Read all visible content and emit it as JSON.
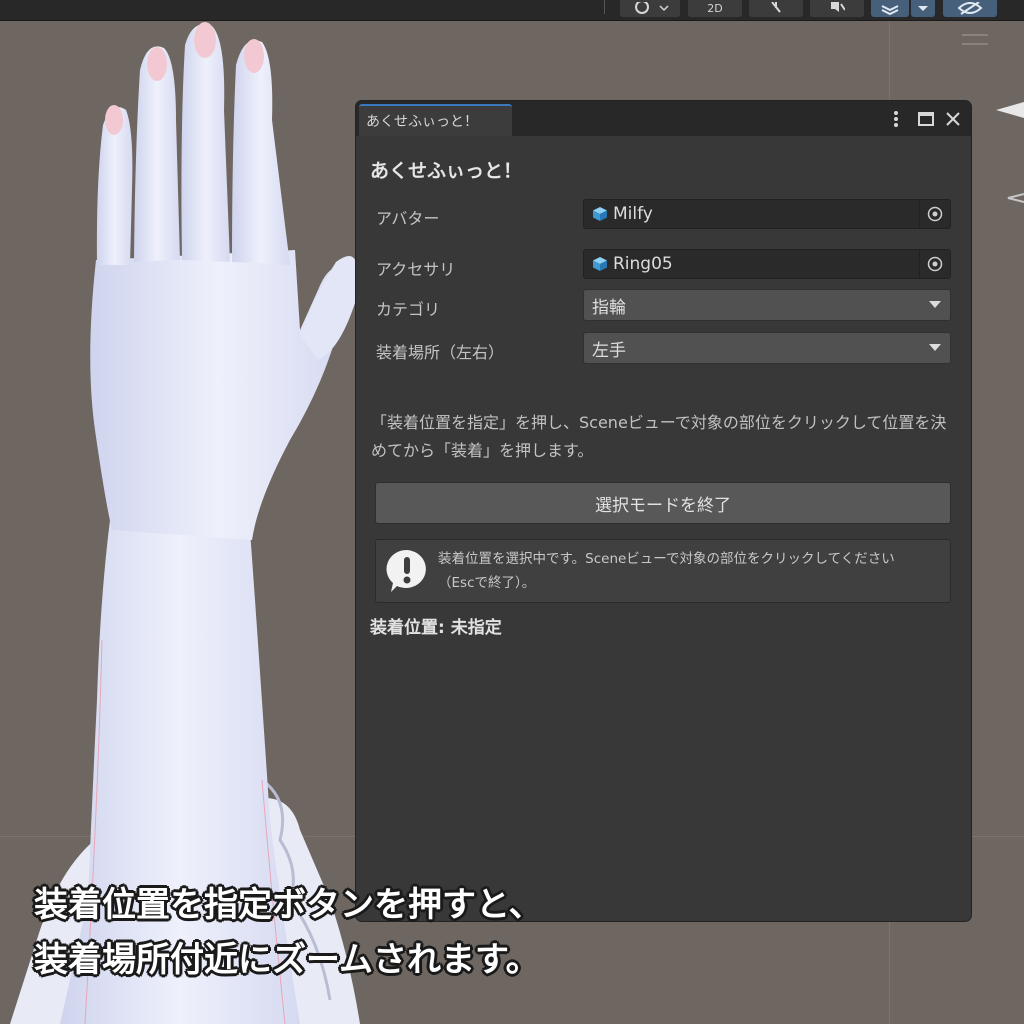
{
  "toolbar": {
    "mode_2d_label": "2D"
  },
  "window": {
    "tab_label": "あくせふぃっと！",
    "title": "あくせふぃっと！",
    "fields": {
      "avatar_label": "アバター",
      "avatar_value": "Milfy",
      "accessory_label": "アクセサリ",
      "accessory_value": "Ring05",
      "category_label": "カテゴリ",
      "category_value": "指輪",
      "side_label": "装着場所（左右）",
      "side_value": "左手"
    },
    "instructions": "「装着位置を指定」を押し、Sceneビューで対象の部位をクリックして位置を決めてから「装着」を押します。",
    "mode_button_label": "選択モードを終了",
    "helpbox": {
      "line1": "装着位置を選択中です。Sceneビューで対象の部位をクリックしてください",
      "line2": "（Escで終了）。"
    },
    "position_status": "装着位置: 未指定"
  },
  "caption": {
    "line1": "装着位置を指定ボタンを押すと、",
    "line2": "装着場所付近にズームされます。"
  },
  "colors": {
    "scene_bg": "#6e6660",
    "window_bg": "#383838",
    "tab_accent": "#3a79bb",
    "cube_icon": "#4aa9e0"
  },
  "icons": {
    "cube": "prefab-cube-icon",
    "target": "object-picker-icon",
    "warning": "warning-speech-icon"
  }
}
